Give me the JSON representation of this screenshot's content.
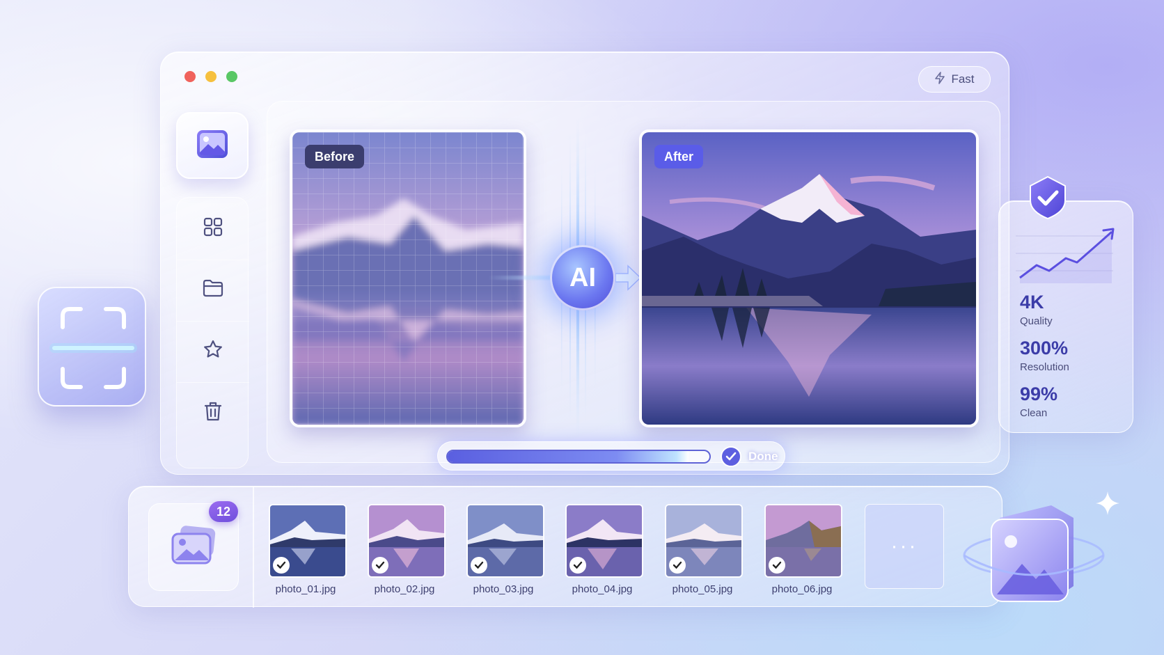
{
  "window": {
    "controls": [
      "close",
      "minimize",
      "maximize"
    ],
    "mode_button": {
      "label": "Fast",
      "icon": "lightning-icon"
    }
  },
  "sidebar": {
    "items": [
      {
        "name": "images",
        "icon": "image-icon",
        "active": true
      },
      {
        "name": "grid",
        "icon": "grid-icon"
      },
      {
        "name": "folder",
        "icon": "folder-icon"
      },
      {
        "name": "favorites",
        "icon": "star-icon"
      },
      {
        "name": "delete",
        "icon": "trash-icon"
      }
    ]
  },
  "comparison": {
    "before_label": "Before",
    "after_label": "After",
    "ai_label": "AI"
  },
  "progress": {
    "value": 0.92,
    "status_label": "Done"
  },
  "stats": [
    {
      "value": "4K",
      "label": "Quality"
    },
    {
      "value": "300%",
      "label": "Resolution"
    },
    {
      "value": "99%",
      "label": "Clean"
    }
  ],
  "gallery": {
    "count": "12",
    "thumbnails": [
      {
        "name": "photo_01.jpg",
        "checked": true
      },
      {
        "name": "photo_02.jpg",
        "checked": true
      },
      {
        "name": "photo_03.jpg",
        "checked": true
      },
      {
        "name": "photo_04.jpg",
        "checked": true
      },
      {
        "name": "photo_05.jpg",
        "checked": true
      },
      {
        "name": "photo_06.jpg",
        "checked": true
      }
    ],
    "more_label": "···"
  },
  "colors": {
    "accent": "#5b5de0",
    "before_tag": "#3b3d6e",
    "after_tag": "#5a5ce8",
    "stat_value": "#3b3ca8"
  }
}
